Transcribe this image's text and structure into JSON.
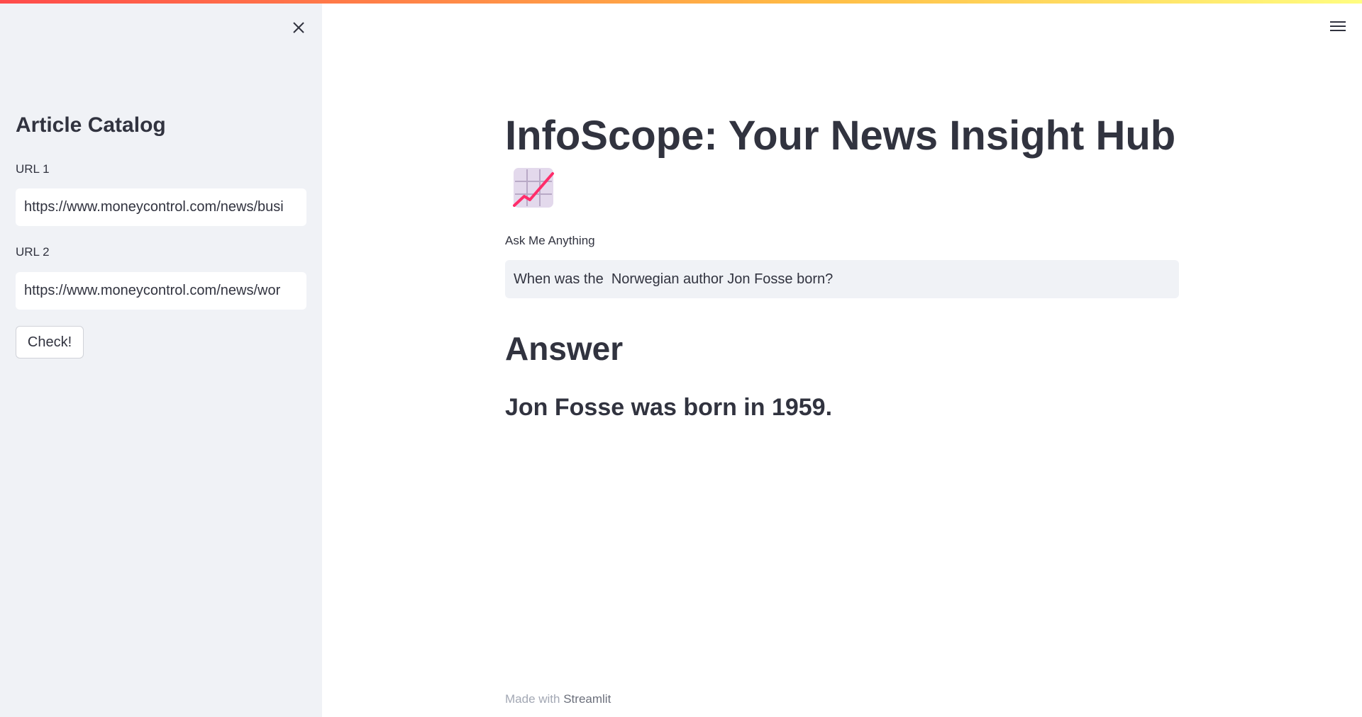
{
  "sidebar": {
    "close_icon": "close-icon",
    "title": "Article Catalog",
    "url1": {
      "label": "URL 1",
      "value": "https://www.moneycontrol.com/news/busi"
    },
    "url2": {
      "label": "URL 2",
      "value": "https://www.moneycontrol.com/news/wor"
    },
    "check_button": "Check!"
  },
  "header": {
    "menu_icon": "hamburger-menu-icon"
  },
  "main": {
    "title": "InfoScope: Your News Insight Hub",
    "title_icon": "chart-increasing-icon",
    "question_label": "Ask Me Anything",
    "question_value": "When was the  Norwegian author Jon Fosse born?",
    "answer_heading": "Answer",
    "answer_text": "Jon Fosse was born in 1959."
  },
  "footer": {
    "prefix": "Made with",
    "link": "Streamlit"
  },
  "colors": {
    "sidebar_bg": "#f0f2f6",
    "text": "#31333f",
    "accent_line": "#ff2d6a",
    "emoji_bg": "#e3d9ec"
  }
}
